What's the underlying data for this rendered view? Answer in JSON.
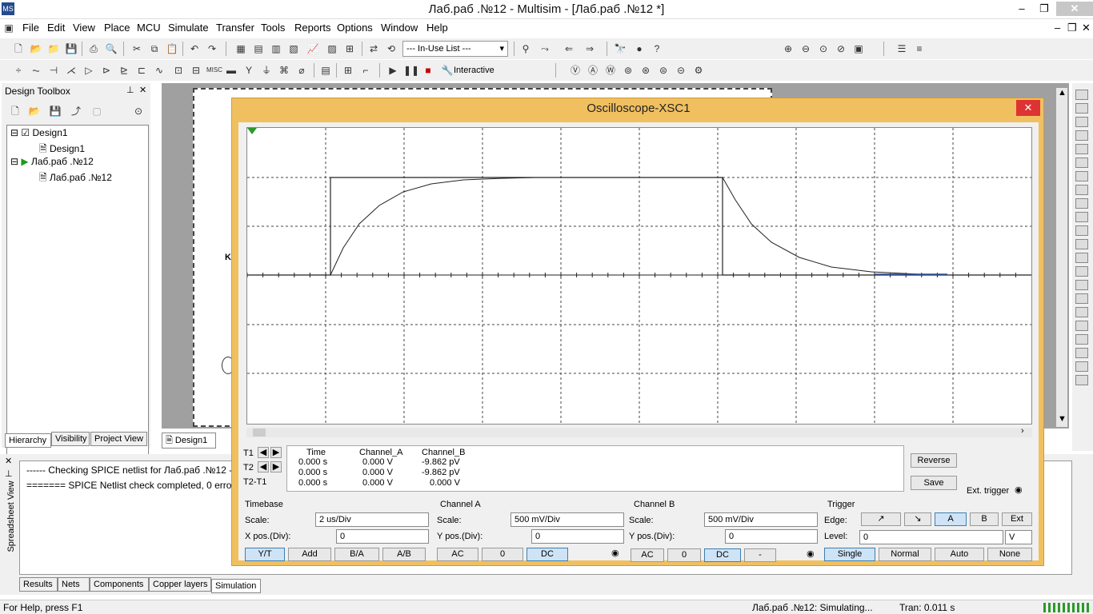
{
  "app": {
    "title": "Лаб.раб .№12 - Multisim - [Лаб.раб .№12 *]",
    "icon_text": "MS",
    "win_min": "–",
    "win_restore": "❐",
    "win_close": "✕"
  },
  "menu": [
    "File",
    "Edit",
    "View",
    "Place",
    "MCU",
    "Simulate",
    "Transfer",
    "Tools",
    "Reports",
    "Options",
    "Window",
    "Help"
  ],
  "toolbar": {
    "in_use_list": "--- In-Use List ---",
    "interactive_label": "Interactive"
  },
  "toolbox": {
    "title": "Design Toolbox",
    "tree": [
      {
        "label": "Design1"
      },
      {
        "label": "Design1"
      },
      {
        "label": "Лаб.раб .№12"
      },
      {
        "label": "Лаб.раб .№12"
      }
    ],
    "tabs": [
      "Hierarchy",
      "Visibility",
      "Project View"
    ]
  },
  "workspace": {
    "sheet_tab": "Design1",
    "partial_label": "K"
  },
  "oscilloscope": {
    "title": "Oscilloscope-XSC1",
    "close": "✕",
    "readout": {
      "headers": [
        "Time",
        "Channel_A",
        "Channel_B"
      ],
      "rows": [
        {
          "label": "T1",
          "time": "0.000 s",
          "a": "0.000 V",
          "b": "-9.862 pV"
        },
        {
          "label": "T2",
          "time": "0.000 s",
          "a": "0.000 V",
          "b": "-9.862 pV"
        },
        {
          "label": "T2-T1",
          "time": "0.000 s",
          "a": "0.000 V",
          "b": "0.000 V"
        }
      ]
    },
    "reverse_button": "Reverse",
    "save_button": "Save",
    "ext_trigger": "Ext. trigger",
    "timebase": {
      "title": "Timebase",
      "scale_label": "Scale:",
      "scale": "2 us/Div",
      "xpos_label": "X pos.(Div):",
      "xpos": "0",
      "buttons": [
        "Y/T",
        "Add",
        "B/A",
        "A/B"
      ]
    },
    "channel_a": {
      "title": "Channel A",
      "scale_label": "Scale:",
      "scale": "500 mV/Div",
      "ypos_label": "Y pos.(Div):",
      "ypos": "0",
      "buttons": [
        "AC",
        "0",
        "DC"
      ]
    },
    "channel_b": {
      "title": "Channel B",
      "scale_label": "Scale:",
      "scale": "500 mV/Div",
      "ypos_label": "Y pos.(Div):",
      "ypos": "0",
      "buttons": [
        "AC",
        "0",
        "DC",
        "-"
      ]
    },
    "trigger": {
      "title": "Trigger",
      "edge_label": "Edge:",
      "edge_buttons": [
        "↗",
        "↘",
        "A",
        "B",
        "Ext"
      ],
      "level_label": "Level:",
      "level": "0",
      "level_unit": "V",
      "mode_buttons": [
        "Single",
        "Normal",
        "Auto",
        "None"
      ]
    }
  },
  "spice_output": {
    "lines": [
      "------ Checking SPICE netlist for Лаб.раб .№12 - ...",
      "======= SPICE Netlist check completed, 0 erro"
    ],
    "side_label": "Spreadsheet View",
    "tabs": [
      "Results",
      "Nets",
      "Components",
      "Copper layers",
      "Simulation"
    ]
  },
  "status": {
    "help": "For Help, press F1",
    "simulating": "Лаб.раб .№12: Simulating...",
    "tran": "Tran: 0.011 s"
  }
}
